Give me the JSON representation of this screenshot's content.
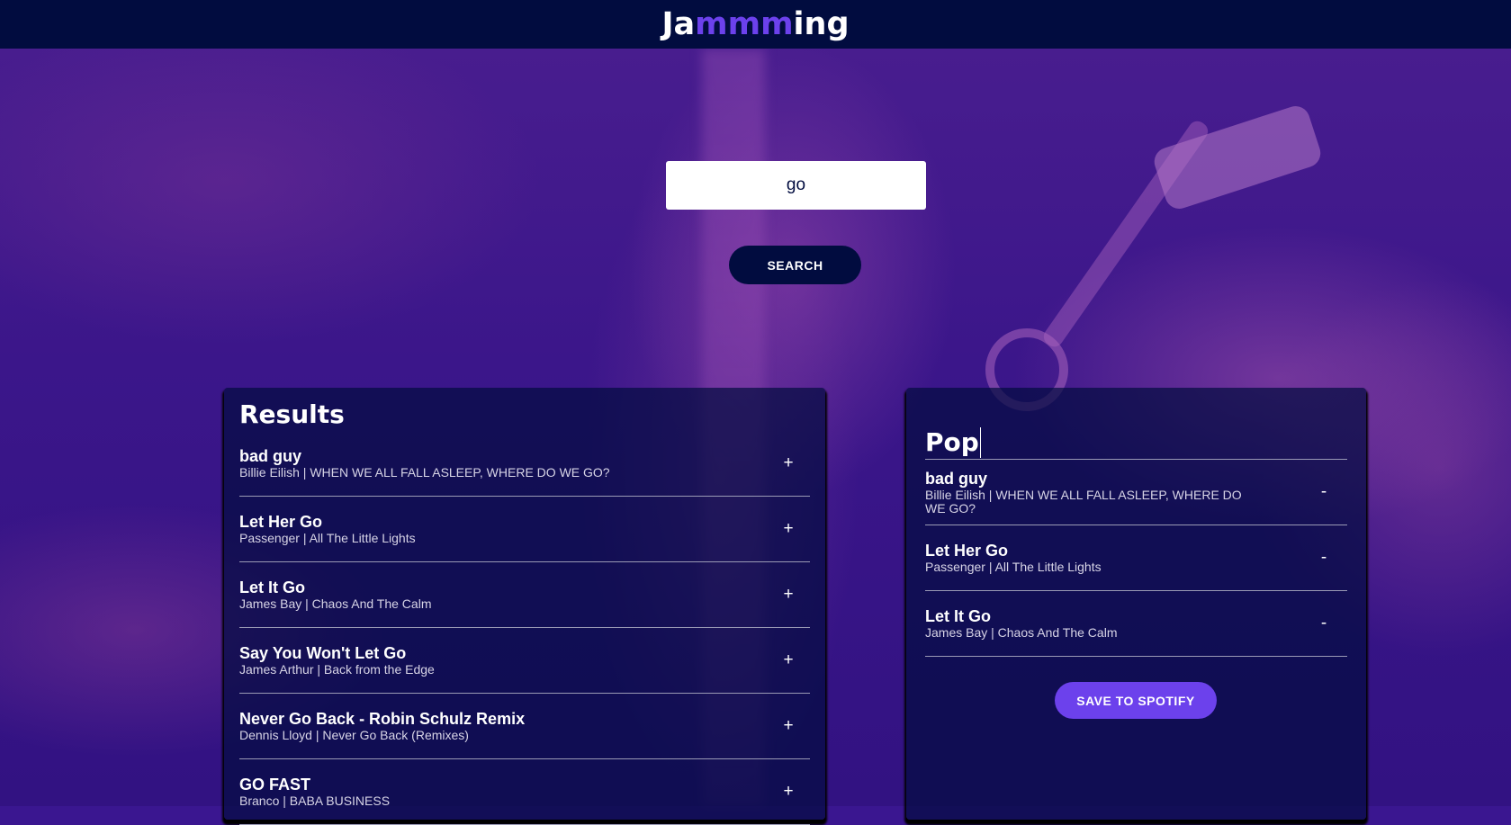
{
  "header": {
    "logo_part1": "Ja",
    "logo_part2": "mmm",
    "logo_part3": "ing"
  },
  "search": {
    "value": "go",
    "button_label": "SEARCH"
  },
  "results": {
    "title": "Results",
    "tracks": [
      {
        "name": "bad guy",
        "meta": "Billie Eilish | WHEN WE ALL FALL ASLEEP, WHERE DO WE GO?",
        "action": "+"
      },
      {
        "name": "Let Her Go",
        "meta": "Passenger | All The Little Lights",
        "action": "+"
      },
      {
        "name": "Let It Go",
        "meta": "James Bay | Chaos And The Calm",
        "action": "+"
      },
      {
        "name": "Say You Won't Let Go",
        "meta": "James Arthur | Back from the Edge",
        "action": "+"
      },
      {
        "name": "Never Go Back - Robin Schulz Remix",
        "meta": "Dennis Lloyd | Never Go Back (Remixes)",
        "action": "+"
      },
      {
        "name": "GO FAST",
        "meta": "Branco | BABA BUSINESS",
        "action": "+"
      }
    ]
  },
  "playlist": {
    "name": "Pop",
    "tracks": [
      {
        "name": "bad guy",
        "meta": "Billie Eilish | WHEN WE ALL FALL ASLEEP, WHERE DO WE GO?",
        "action": "-"
      },
      {
        "name": "Let Her Go",
        "meta": "Passenger | All The Little Lights",
        "action": "-"
      },
      {
        "name": "Let It Go",
        "meta": "James Bay | Chaos And The Calm",
        "action": "-"
      }
    ],
    "save_label": "SAVE TO SPOTIFY"
  },
  "colors": {
    "navy": "#010c3f",
    "accent": "#6c41ec",
    "background": "#3a1690"
  }
}
